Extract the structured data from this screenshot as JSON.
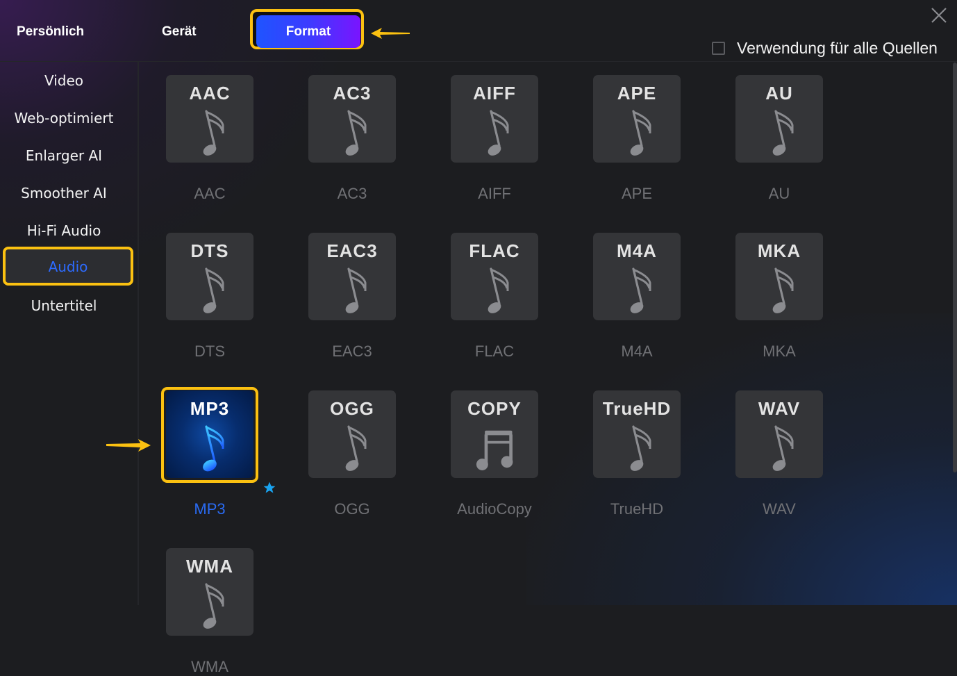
{
  "header": {
    "tabs": [
      {
        "label": "Persönlich",
        "active": false
      },
      {
        "label": "Gerät",
        "active": false
      },
      {
        "label": "Format",
        "active": true
      }
    ],
    "close_icon": "close-x",
    "apply_all": {
      "label": "Verwendung für alle Quellen",
      "checked": false
    }
  },
  "sidebar": {
    "items": [
      {
        "label": "Video",
        "active": false
      },
      {
        "label": "Web-optimiert",
        "active": false
      },
      {
        "label": "Enlarger AI",
        "active": false
      },
      {
        "label": "Smoother AI",
        "active": false
      },
      {
        "label": "Hi-Fi Audio",
        "active": false
      },
      {
        "label": "Audio",
        "active": true
      },
      {
        "label": "Untertitel",
        "active": false
      }
    ]
  },
  "formats": [
    {
      "icon_text": "AAC",
      "label": "AAC",
      "icon": "music-note-icon",
      "selected": false
    },
    {
      "icon_text": "AC3",
      "label": "AC3",
      "icon": "music-note-icon",
      "selected": false
    },
    {
      "icon_text": "AIFF",
      "label": "AIFF",
      "icon": "music-note-icon",
      "selected": false
    },
    {
      "icon_text": "APE",
      "label": "APE",
      "icon": "music-note-icon",
      "selected": false
    },
    {
      "icon_text": "AU",
      "label": "AU",
      "icon": "music-note-icon",
      "selected": false
    },
    {
      "icon_text": "DTS",
      "label": "DTS",
      "icon": "music-note-icon",
      "selected": false
    },
    {
      "icon_text": "EAC3",
      "label": "EAC3",
      "icon": "music-note-icon",
      "selected": false
    },
    {
      "icon_text": "FLAC",
      "label": "FLAC",
      "icon": "music-note-icon",
      "selected": false
    },
    {
      "icon_text": "M4A",
      "label": "M4A",
      "icon": "music-note-icon",
      "selected": false
    },
    {
      "icon_text": "MKA",
      "label": "MKA",
      "icon": "music-note-icon",
      "selected": false
    },
    {
      "icon_text": "MP3",
      "label": "MP3",
      "icon": "music-note-icon",
      "selected": true,
      "favorite": true
    },
    {
      "icon_text": "OGG",
      "label": "OGG",
      "icon": "music-note-icon",
      "selected": false
    },
    {
      "icon_text": "COPY",
      "label": "AudioCopy",
      "icon": "beamed-notes-icon",
      "selected": false
    },
    {
      "icon_text": "TrueHD",
      "label": "TrueHD",
      "icon": "music-note-icon",
      "selected": false
    },
    {
      "icon_text": "WAV",
      "label": "WAV",
      "icon": "music-note-icon",
      "selected": false
    },
    {
      "icon_text": "WMA",
      "label": "WMA",
      "icon": "music-note-icon",
      "selected": false
    }
  ],
  "colors": {
    "highlight": "#fbc111",
    "accent_blue": "#2a6bf2",
    "background": "#1c1d20",
    "tile": "#343538"
  }
}
